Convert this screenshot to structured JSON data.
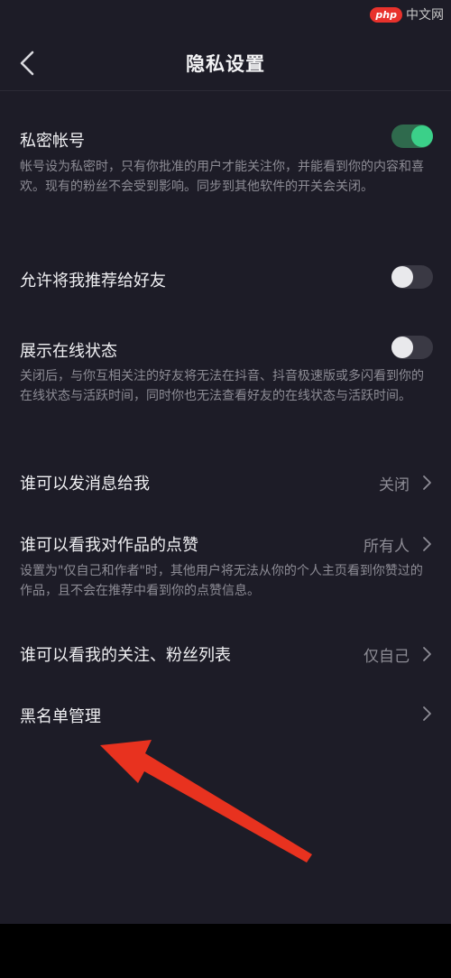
{
  "header": {
    "title": "隐私设置",
    "back_icon": "chevron-left-icon"
  },
  "watermark": {
    "logo": "php",
    "text": "中文网"
  },
  "settings": {
    "private_account": {
      "label": "私密帐号",
      "description": "帐号设为私密时，只有你批准的用户才能关注你，并能看到你的内容和喜欢。现有的粉丝不会受到影响。同步到其他软件的开关会关闭。",
      "enabled": true
    },
    "recommend_to_friends": {
      "label": "允许将我推荐给好友",
      "enabled": false
    },
    "online_status": {
      "label": "展示在线状态",
      "description": "关闭后，与你互相关注的好友将无法在抖音、抖音极速版或多闪看到你的在线状态与活跃时间，同时你也无法查看好友的在线状态与活跃时间。",
      "enabled": false
    },
    "who_can_message": {
      "label": "谁可以发消息给我",
      "value": "关闭"
    },
    "who_can_see_likes": {
      "label": "谁可以看我对作品的点赞",
      "value": "所有人",
      "description": "设置为\"仅自己和作者\"时，其他用户将无法从你的个人主页看到你赞过的作品，且不会在推荐中看到你的点赞信息。"
    },
    "who_can_see_follow_list": {
      "label": "谁可以看我的关注、粉丝列表",
      "value": "仅自己"
    },
    "blacklist": {
      "label": "黑名单管理"
    }
  },
  "colors": {
    "background": "#1d1c27",
    "toggle_on": "#3bd089",
    "annotation_arrow": "#e8321f"
  }
}
